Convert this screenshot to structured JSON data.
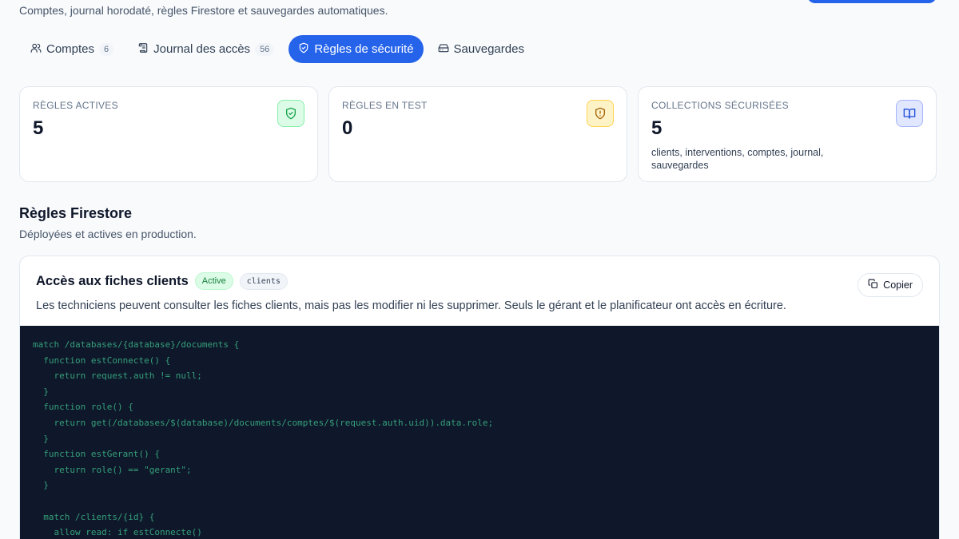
{
  "header": {
    "subtitle": "Comptes, journal horodaté, règles Firestore et sauvegardes automatiques."
  },
  "tabs": [
    {
      "label": "Comptes",
      "count": "6",
      "icon": "users-icon"
    },
    {
      "label": "Journal des accès",
      "count": "56",
      "icon": "scroll-icon"
    },
    {
      "label": "Règles de sécurité",
      "count": "",
      "icon": "shield-icon",
      "active": true
    },
    {
      "label": "Sauvegardes",
      "count": "",
      "icon": "drive-icon"
    }
  ],
  "stats": [
    {
      "label": "Règles actives",
      "value": "5",
      "desc": "",
      "icon": "shield-check-icon",
      "color": "#16a34a"
    },
    {
      "label": "Règles en test",
      "value": "0",
      "desc": "",
      "icon": "shield-alert-icon",
      "color": "#a16207"
    },
    {
      "label": "Collections sécurisées",
      "value": "5",
      "desc": "clients, interventions, comptes, journal, sauvegardes",
      "icon": "book-icon",
      "color": "#1d4ed8"
    }
  ],
  "section": {
    "title": "Règles Firestore",
    "subtitle": "Déployées et actives en production."
  },
  "rule": {
    "title": "Accès aux fiches clients",
    "status": "Active",
    "collection": "clients",
    "copy_label": "Copier",
    "description": "Les techniciens peuvent consulter les fiches clients, mais pas les modifier ni les supprimer. Seuls le gérant et le planificateur ont accès en écriture.",
    "code": [
      "match /databases/{database}/documents {",
      "  function estConnecte() {",
      "    return request.auth != null;",
      "  }",
      "  function role() {",
      "    return get(/databases/$(database)/documents/comptes/$(request.auth.uid)).data.role;",
      "  }",
      "  function estGerant() {",
      "    return role() == \"gerant\";",
      "  }",
      "",
      "  match /clients/{id} {",
      "    allow read: if estConnecte()"
    ]
  },
  "colors": {
    "accent": "#2563eb",
    "code_bg": "#0f172a",
    "code_text": "#34a07a"
  }
}
